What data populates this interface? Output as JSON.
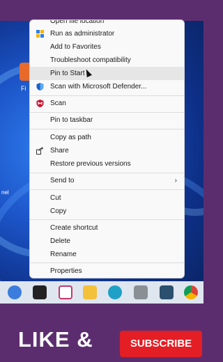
{
  "menu": {
    "items": [
      {
        "label": "Open file location",
        "icon": "none"
      },
      {
        "label": "Run as administrator",
        "icon": "shield-icon"
      },
      {
        "label": "Add to Favorites",
        "icon": "none"
      },
      {
        "label": "Troubleshoot compatibility",
        "icon": "none"
      },
      {
        "label": "Pin to Start",
        "icon": "none"
      },
      {
        "label": "Scan with Microsoft Defender...",
        "icon": "defender-icon"
      },
      {
        "label": "Scan",
        "icon": "mcafee-icon"
      },
      {
        "label": "Pin to taskbar",
        "icon": "none"
      },
      {
        "label": "Copy as path",
        "icon": "none"
      },
      {
        "label": "Share",
        "icon": "share-icon"
      },
      {
        "label": "Restore previous versions",
        "icon": "none"
      },
      {
        "label": "Send to",
        "icon": "none"
      },
      {
        "label": "Cut",
        "icon": "none"
      },
      {
        "label": "Copy",
        "icon": "none"
      },
      {
        "label": "Create shortcut",
        "icon": "none"
      },
      {
        "label": "Delete",
        "icon": "none"
      },
      {
        "label": "Rename",
        "icon": "none"
      },
      {
        "label": "Properties",
        "icon": "none"
      }
    ],
    "submenu_arrow": "›"
  },
  "desktop": {
    "icon_label": "Fi",
    "side_label": "nel"
  },
  "taskbar": {
    "icons": [
      "copilot-icon",
      "taskview-icon",
      "snipping-tool-icon",
      "file-explorer-icon",
      "edge-icon",
      "printer-icon",
      "feedback-icon",
      "chrome-icon"
    ]
  },
  "overlay": {
    "like_text": "LIKE &",
    "subscribe_text": "SUBSCRIBE"
  },
  "colors": {
    "frame": "#5c2d6e",
    "subscribe": "#e31e24",
    "menu_bg": "#f9f9f9",
    "hover": "#e6e6e6"
  }
}
